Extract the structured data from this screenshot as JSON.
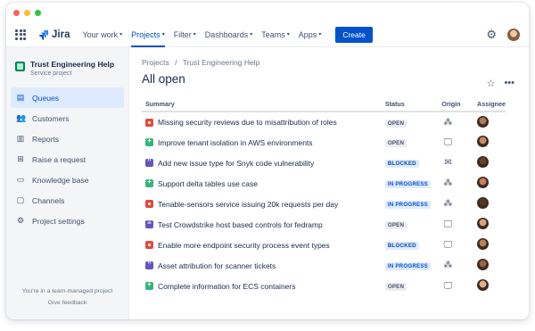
{
  "app": {
    "logo_text": "Jira"
  },
  "nav": {
    "items": [
      {
        "label": "Your work",
        "active": false
      },
      {
        "label": "Projects",
        "active": true
      },
      {
        "label": "Filter",
        "active": false
      },
      {
        "label": "Dashboards",
        "active": false
      },
      {
        "label": "Teams",
        "active": false
      },
      {
        "label": "Apps",
        "active": false
      }
    ],
    "create_label": "Create"
  },
  "sidebar": {
    "project_name": "Trust Engineering Help",
    "project_type": "Service project",
    "items": [
      {
        "label": "Queues",
        "icon": "queues-icon",
        "active": true
      },
      {
        "label": "Customers",
        "icon": "customers-icon",
        "active": false
      },
      {
        "label": "Reports",
        "icon": "reports-icon",
        "active": false
      },
      {
        "label": "Raise a request",
        "icon": "raise-request-icon",
        "active": false
      },
      {
        "label": "Knowledge base",
        "icon": "knowledge-base-icon",
        "active": false
      },
      {
        "label": "Channels",
        "icon": "channels-icon",
        "active": false
      },
      {
        "label": "Project settings",
        "icon": "settings-icon",
        "active": false
      }
    ],
    "footer_text": "You're in a team-managed project",
    "footer_link": "Give feedback"
  },
  "breadcrumb": [
    "Projects",
    "/",
    "Trust Engineering Help"
  ],
  "page_title": "All open",
  "table": {
    "headers": {
      "summary": "Summary",
      "status": "Status",
      "origin": "Origin",
      "assignee": "Assignee"
    },
    "rows": [
      {
        "type": "bug",
        "summary": "Missing security reviews due to misattribution of roles",
        "status": "OPEN",
        "origin": "slack-icon",
        "avatar": "#b0785a"
      },
      {
        "type": "story",
        "summary": "Improve tenant isolation in AWS environments",
        "status": "OPEN",
        "origin": "monitor-icon",
        "avatar": "#c98a64"
      },
      {
        "type": "task",
        "summary": "Add new issue type for Snyk code vulnerability",
        "status": "BLOCKED",
        "origin": "email-icon",
        "avatar": "#6b3f2a"
      },
      {
        "type": "story",
        "summary": "Support delta tables use case",
        "status": "IN PROGRESS",
        "origin": "slack-icon",
        "avatar": "#d07a5c"
      },
      {
        "type": "bug",
        "summary": "Tenable-sensors service issuing 20k requests per day",
        "status": "IN PROGRESS",
        "origin": "slack-icon",
        "avatar": "#5a3525"
      },
      {
        "type": "doc",
        "summary": "Test Crowdstrike host based controls for fedramp",
        "status": "OPEN",
        "origin": "monitor-icon",
        "avatar": "#d9a47c"
      },
      {
        "type": "bug",
        "summary": "Enable more endpoint security process event types",
        "status": "BLOCKED",
        "origin": "monitor-icon",
        "avatar": "#b9805e"
      },
      {
        "type": "task",
        "summary": "Asset attribution for scanner tickets",
        "status": "IN PROGRESS",
        "origin": "slack-icon",
        "avatar": "#9a6248"
      },
      {
        "type": "story",
        "summary": "Complete information for ECS containers",
        "status": "OPEN",
        "origin": "monitor-icon",
        "avatar": "#e0b08a"
      }
    ]
  },
  "colors": {
    "accent": "#0052cc",
    "bug": "#e5493a",
    "story": "#36b37e",
    "task": "#6554c0"
  }
}
